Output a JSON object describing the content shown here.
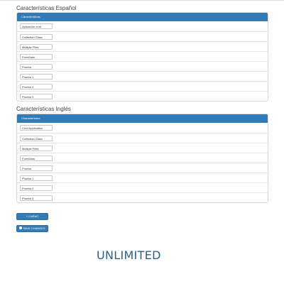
{
  "sections": [
    {
      "title": "Características Español",
      "heading": "Características",
      "values": [
        "Aplicación crud",
        "Collection Class",
        "Multiple Files",
        "FormData",
        "Prueba",
        "Prueba 1",
        "Prueba 2",
        "Prueba 3"
      ]
    },
    {
      "title": "Características Inglés",
      "heading": "Characteristics",
      "values": [
        "Crud Application",
        "Collection Class",
        "Multiple Files",
        "FormData",
        "Prueba",
        "Prueba 1",
        "Prueba 2",
        "Prueba 3"
      ]
    }
  ],
  "buttons": {
    "add_label": "+ CARAC",
    "save_label": "SAVE CHANGES"
  },
  "watermark": "UNLIMITED"
}
